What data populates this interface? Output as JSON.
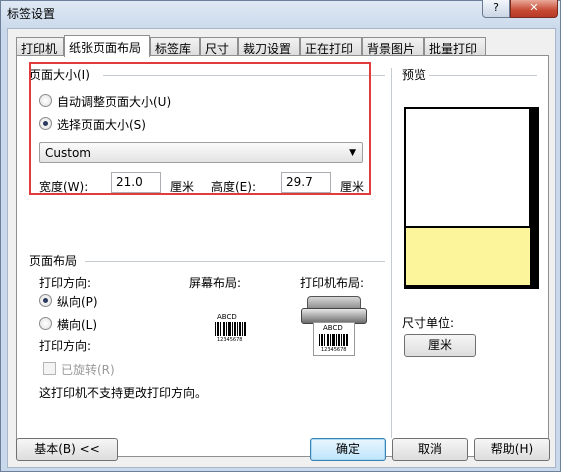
{
  "window": {
    "title": "标签设置",
    "help_label": "?",
    "close_label": "✕"
  },
  "tabs": [
    {
      "label": "打印机",
      "active": false
    },
    {
      "label": "纸张页面布局",
      "active": true
    },
    {
      "label": "标签库",
      "active": false
    },
    {
      "label": "尺寸",
      "active": false
    },
    {
      "label": "裁刀设置",
      "active": false
    },
    {
      "label": "正在打印",
      "active": false
    },
    {
      "label": "背景图片",
      "active": false
    },
    {
      "label": "批量打印",
      "active": false
    }
  ],
  "page_size": {
    "group_label": "页面大小(I)",
    "auto_option": "自动调整页面大小(U)",
    "select_option": "选择页面大小(S)",
    "selected": "select",
    "dropdown_value": "Custom",
    "width_label": "宽度(W):",
    "width_value": "21.0",
    "width_unit": "厘米",
    "height_label": "高度(E):",
    "height_value": "29.7",
    "height_unit": "厘米"
  },
  "preview": {
    "label": "预览"
  },
  "layout": {
    "group_label": "页面布局",
    "print_dir_label": "打印方向:",
    "portrait": "纵向(P)",
    "landscape": "横向(L)",
    "orientation_selected": "portrait",
    "print_dir_label2": "打印方向:",
    "rotated": "已旋转(R)",
    "screen_layout": "屏幕布局:",
    "printer_layout": "打印机布局:",
    "note": "这打印机不支持更改打印方向。",
    "sample_text": "ABCD",
    "sample_number": "12345678"
  },
  "units": {
    "label": "尺寸单位:",
    "button": "厘米"
  },
  "footer": {
    "basic": "基本(B) <<",
    "ok": "确定",
    "cancel": "取消",
    "help": "帮助(H)"
  },
  "colors": {
    "highlight": "#e23b3b",
    "preview_fill": "#fdf59b"
  }
}
